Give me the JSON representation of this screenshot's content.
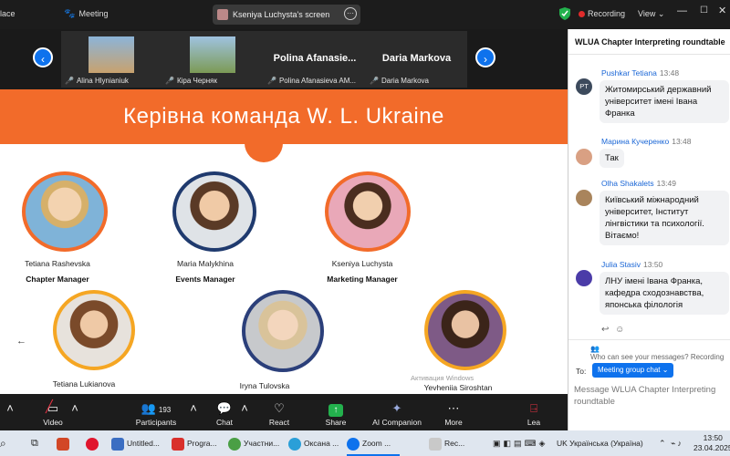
{
  "topbar": {
    "left_fragment": "lace",
    "meeting_label": "Meeting",
    "sharing_label": "Kseniya Luchysta's screen",
    "recording_label": "Recording",
    "view_label": "View"
  },
  "thumbnails": [
    {
      "name": "Alina Hlynianiuk"
    },
    {
      "name": "Кіра Черняк"
    },
    {
      "display": "Polina Afanasie...",
      "name": "Polina Afanasieva AM..."
    },
    {
      "display": "Daria Markova",
      "name": "Daria Markova"
    }
  ],
  "slide": {
    "title": "Керівна команда W. L. Ukraine",
    "people": [
      {
        "name": "Tetiana Rashevska",
        "role": "Chapter Manager"
      },
      {
        "name": "Maria Malykhina",
        "role": "Events Manager"
      },
      {
        "name": "Kseniya Luchysta",
        "role": "Marketing Manager"
      },
      {
        "name": "Tetiana Lukianova",
        "role": ""
      },
      {
        "name": "Iryna Tulovska",
        "role": ""
      },
      {
        "name": "Yevheniia Siroshtan",
        "role": ""
      }
    ],
    "watermark": "Активация Windows"
  },
  "toolbar": {
    "video": "Video",
    "participants": "Participants",
    "participants_count": "193",
    "chat": "Chat",
    "react": "React",
    "share": "Share",
    "ai": "AI Companion",
    "more": "More",
    "leave": "Lea"
  },
  "chat": {
    "title": "WLUA Chapter Interpreting roundtable",
    "messages": [
      {
        "sender": "Pushkar Tetiana",
        "time": "13:48",
        "initials": "PT",
        "text": "Житомирський державний університет імені Івана Франка"
      },
      {
        "sender": "Марина Кучеренко",
        "time": "13:48",
        "initials": "",
        "text": "Так"
      },
      {
        "sender": "Olha Shakalets",
        "time": "13:49",
        "initials": "",
        "text": "Київський міжнародний університет, Інститут лінгвістики та психології. Вітаємо!"
      },
      {
        "sender": "Julia Stasiv",
        "time": "13:50",
        "initials": "",
        "text": "ЛНУ імені Івана Франка, кафедра сходознавства, японська філологія"
      }
    ],
    "who_can_see": "Who can see your messages? Recording",
    "to_label": "To:",
    "to_target": "Meeting group chat",
    "message_placeholder": "Message WLUA Chapter Interpreting roundtable"
  },
  "taskbar": {
    "apps": [
      {
        "label": "Untitled..."
      },
      {
        "label": "Progra..."
      },
      {
        "label": "Участни..."
      },
      {
        "label": "Оксана ..."
      },
      {
        "label": "Zoom ..."
      },
      {
        "label": "Rec..."
      }
    ],
    "language": "UK Українська (Україна)",
    "time": "13:50",
    "date": "23.04.2025"
  },
  "colors": {
    "accent": "#0e72ed",
    "banner": "#f26b2a"
  }
}
